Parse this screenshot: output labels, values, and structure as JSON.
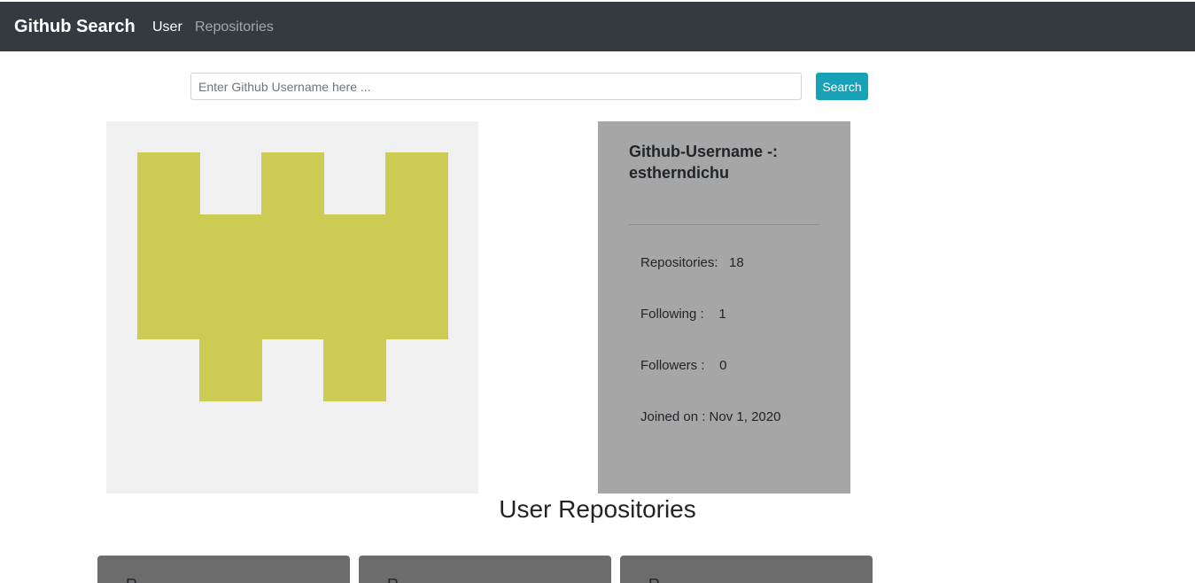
{
  "navbar": {
    "brand": "Github Search",
    "links": [
      "User",
      "Repositories"
    ]
  },
  "search": {
    "placeholder": "Enter Github Username here ...",
    "button_label": "Search"
  },
  "avatar": {
    "colors": {
      "background": "#f0f0f0",
      "foreground": "#cccc55"
    }
  },
  "profile": {
    "username_line1": "Github-Username -:",
    "username_line2": "estherndichu",
    "repositories": "Repositories:   18",
    "following": "Following :    1",
    "followers": "Followers :    0",
    "joined": "Joined on : Nov 1, 2020"
  },
  "repos_section": {
    "heading": "User Repositories",
    "cards": [
      "R",
      "R",
      "R"
    ]
  },
  "colors": {
    "navbar": "#343a40",
    "accent": "#17a2b8",
    "info_card": "#a6a6a6",
    "repo_card": "#6c6c6c"
  }
}
